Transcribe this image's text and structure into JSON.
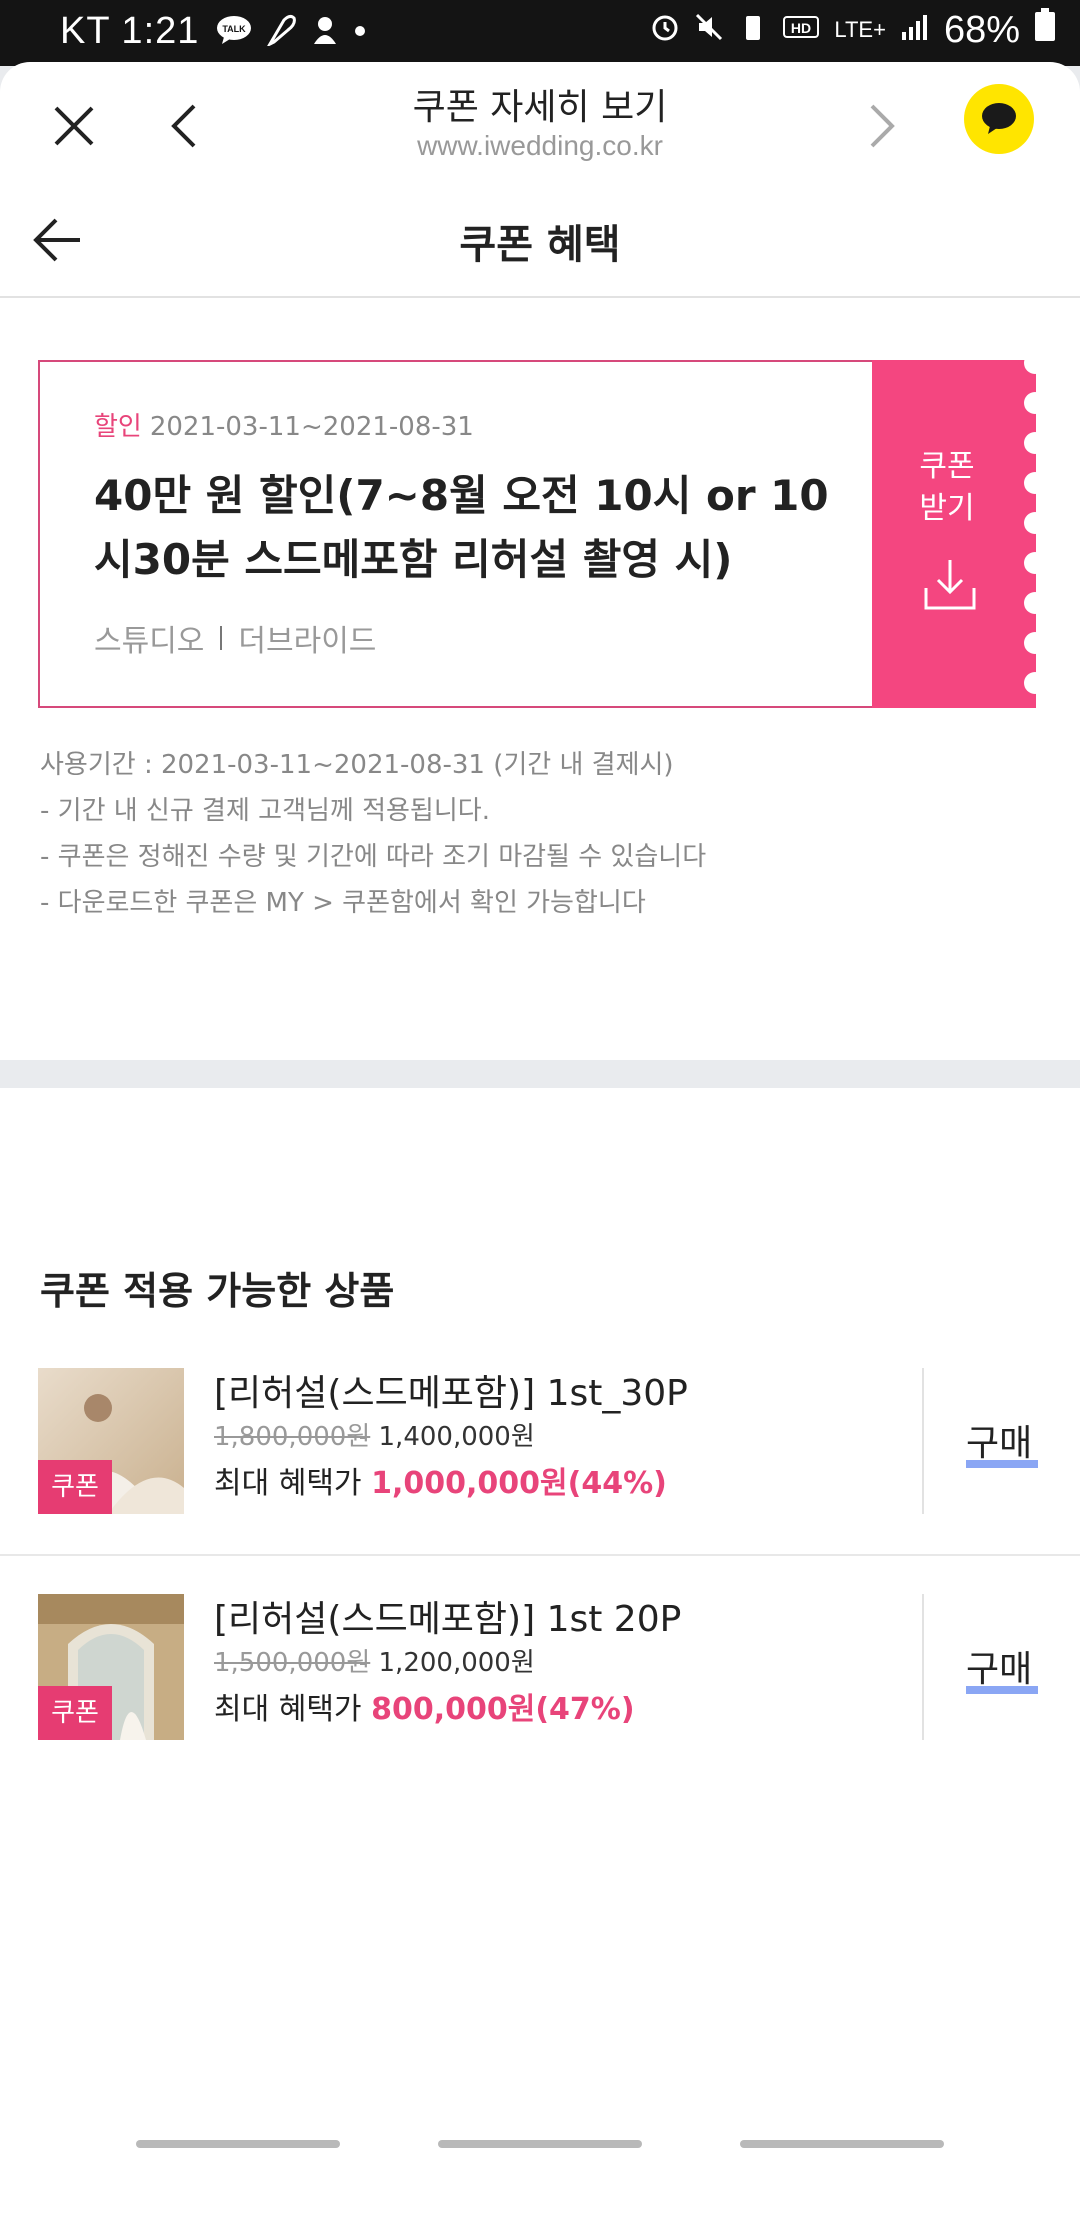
{
  "status_bar": {
    "carrier_time": "KT 1:21",
    "battery": "68%",
    "network": "LTE+"
  },
  "browser": {
    "page_title": "쿠폰 자세히 보기",
    "url": "www.iwedding.co.kr"
  },
  "header": {
    "title": "쿠폰 혜택"
  },
  "coupon": {
    "tag": "할인",
    "period": "2021-03-11~2021-08-31",
    "title": "40만 원 할인(7~8월 오전 10시 or 10시30분 스드메포함 리허설 촬영 시)",
    "category": "스튜디오",
    "vendor": "더브라이드",
    "download_label": "쿠폰\n받기"
  },
  "notes": {
    "usage_period": "사용기간 : 2021-03-11~2021-08-31 (기간 내 결제시)",
    "lines": [
      "- 기간 내 신규 결제 고객님께 적용됩니다.",
      "- 쿠폰은 정해진 수량 및 기간에 따라 조기 마감될 수 있습니다",
      "- 다운로드한 쿠폰은 MY > 쿠폰함에서 확인 가능합니다"
    ]
  },
  "products_section": {
    "title": "쿠폰 적용 가능한 상품",
    "items": [
      {
        "name": "[리허설(스드메포함)] 1st_30P",
        "original_price": "1,800,000원",
        "price": "1,400,000원",
        "benefit_label": "최대 혜택가",
        "benefit_value": "1,000,000원(44%)",
        "badge": "쿠폰",
        "buy_label": "구매"
      },
      {
        "name": "[리허설(스드메포함)] 1st 20P",
        "original_price": "1,500,000원",
        "price": "1,200,000원",
        "benefit_label": "최대 혜택가",
        "benefit_value": "800,000원(47%)",
        "badge": "쿠폰",
        "buy_label": "구매"
      }
    ]
  },
  "colors": {
    "accent_pink": "#f44680",
    "kakao_yellow": "#ffe500",
    "buy_underline": "#8aa6f4"
  }
}
